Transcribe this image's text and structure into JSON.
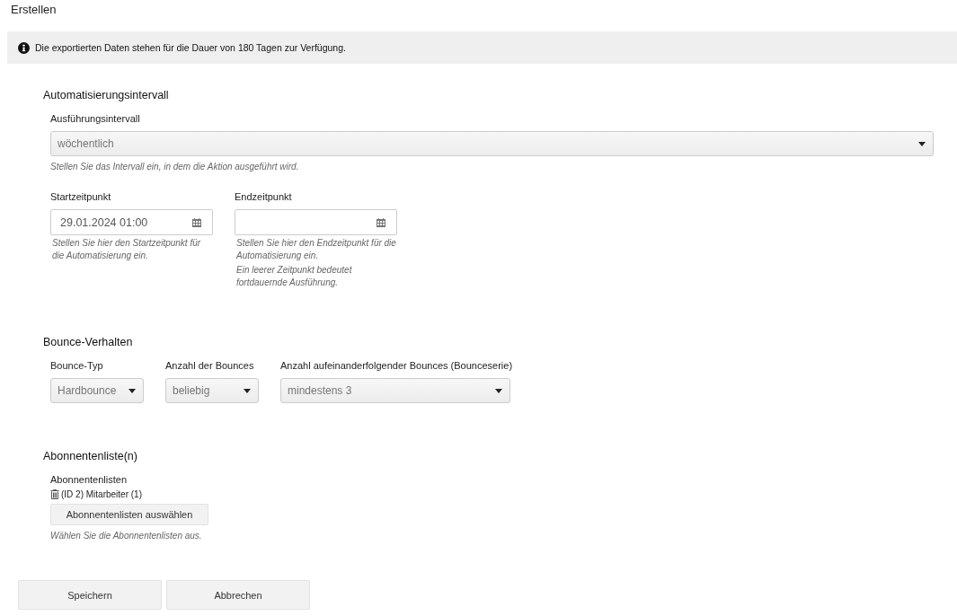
{
  "page_title": "Erstellen",
  "notice": {
    "text": "Die exportierten Daten stehen für die Dauer von 180 Tagen zur Verfügung."
  },
  "sections": [
    {
      "kind": "interval",
      "heading": "Automatisierungsintervall",
      "interval": {
        "label": "Ausführungsintervall",
        "value": "wöchentlich",
        "help": "Stellen Sie das Intervall ein, in dem die Aktion ausgeführt wird."
      },
      "dates": [
        {
          "label": "Startzeitpunkt",
          "value": "29.01.2024 01:00",
          "help": [
            "Stellen Sie hier den Startzeitpunkt für die Automatisierung ein."
          ]
        },
        {
          "label": "Endzeitpunkt",
          "help": [
            "Stellen Sie hier den Endzeitpunkt für die Automatisierung ein.",
            "Ein leerer Zeitpunkt bedeutet fortdauernde Ausführung."
          ]
        }
      ]
    },
    {
      "kind": "bounce",
      "heading": "Bounce-Verhalten",
      "selects": [
        {
          "label": "Bounce-Typ",
          "value": "Hardbounce"
        },
        {
          "label": "Anzahl der Bounces",
          "value": "beliebig"
        },
        {
          "label": "Anzahl aufeinanderfolgender Bounces (Bounceserie)",
          "value": "mindestens 3"
        }
      ]
    },
    {
      "kind": "lists",
      "heading": "Abonnentenliste(n)",
      "label": "Abonnentenlisten",
      "items": [
        "(ID 2) Mitarbeiter (1)"
      ],
      "button": "Abonnentenlisten auswählen",
      "help": "Wählen Sie die Abonnentenlisten aus."
    }
  ],
  "buttons": [
    "Speichern",
    "Abbrechen"
  ]
}
